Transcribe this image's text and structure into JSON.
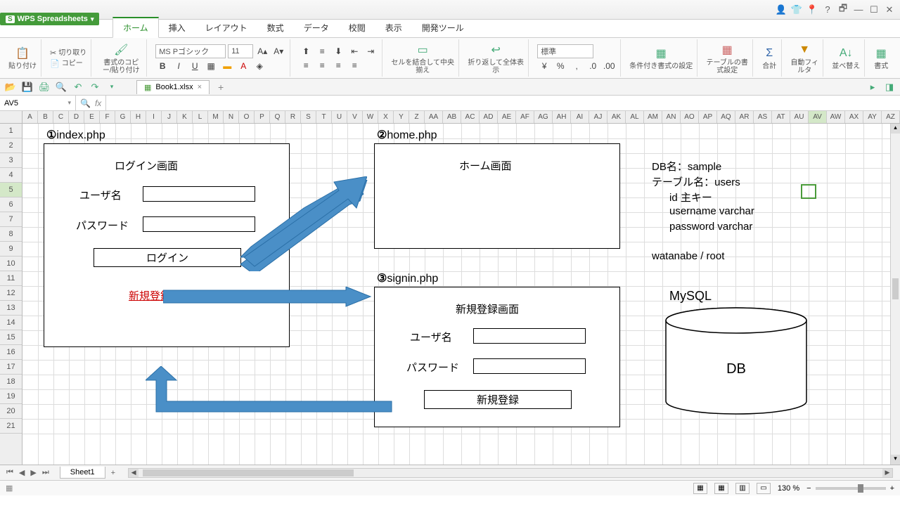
{
  "app": {
    "name": "WPS Spreadsheets"
  },
  "ribbon_tabs": [
    "ホーム",
    "挿入",
    "レイアウト",
    "数式",
    "データ",
    "校閲",
    "表示",
    "開発ツール"
  ],
  "ribbon": {
    "paste": "貼り付け",
    "cut": "切り取り",
    "copy": "コピー",
    "format_painter": "書式のコピー/貼り付け",
    "font_name": "MS Pゴシック",
    "font_size": "11",
    "merge_center": "セルを結合して中央揃え",
    "wrap": "折り返して全体表示",
    "number_format": "標準",
    "cond_format": "条件付き書式の設定",
    "table_format": "テーブルの書式設定",
    "sum": "合計",
    "filter": "自動フィルタ",
    "sort": "並べ替え",
    "format": "書式"
  },
  "qat": {
    "file_tab": "Book1.xlsx"
  },
  "namebox": "AV5",
  "fx_label": "fx",
  "columns_first": [
    "A",
    "B",
    "C",
    "D",
    "E",
    "F",
    "G",
    "H",
    "I",
    "J",
    "K",
    "L",
    "M",
    "N",
    "O",
    "P",
    "Q",
    "R",
    "S",
    "T",
    "U",
    "V",
    "W",
    "X",
    "Y",
    "Z"
  ],
  "columns_rest": [
    "AA",
    "AB",
    "AC",
    "AD",
    "AE",
    "AF",
    "AG",
    "AH",
    "AI",
    "AJ",
    "AK",
    "AL",
    "AM",
    "AN",
    "AO",
    "AP",
    "AQ",
    "AR",
    "AS",
    "AT",
    "AU",
    "AV",
    "AW",
    "AX",
    "AY",
    "AZ"
  ],
  "rows": 21,
  "diagram": {
    "box1": {
      "num": "①",
      "file": "index.php",
      "heading": "ログイン画面",
      "user_label": "ユーザ名",
      "pass_label": "パスワード",
      "login_btn": "ログイン",
      "signup_link": "新規登録"
    },
    "box2": {
      "num": "②",
      "file": "home.php",
      "heading": "ホーム画面"
    },
    "box3": {
      "num": "③",
      "file": "signin.php",
      "heading": "新規登録画面",
      "user_label": "ユーザ名",
      "pass_label": "パスワード",
      "submit_btn": "新規登録"
    },
    "db": {
      "line1": "DB名：sample",
      "line2": "テーブル名：users",
      "col1": "id 主キー",
      "col2": "username varchar",
      "col3": "password varchar",
      "creds": "watanabe / root",
      "mysql": "MySQL",
      "dblabel": "DB"
    }
  },
  "sheet": {
    "name": "Sheet1"
  },
  "status": {
    "zoom": "130 %"
  }
}
